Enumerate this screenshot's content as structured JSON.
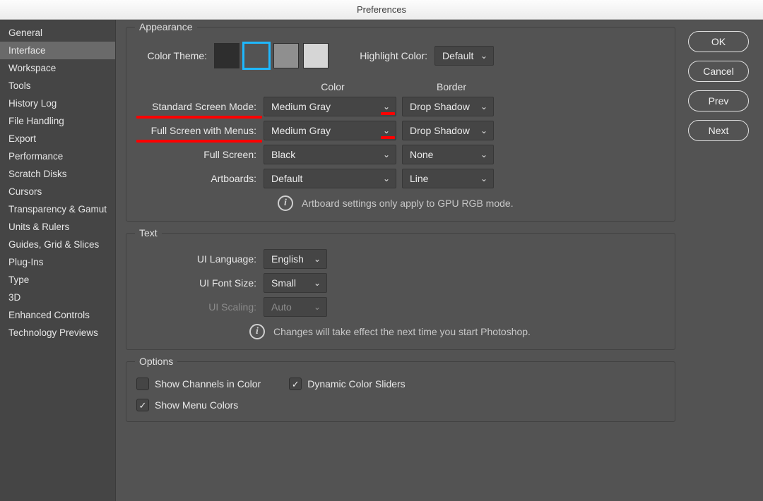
{
  "window": {
    "title": "Preferences"
  },
  "sidebar": {
    "items": [
      {
        "label": "General"
      },
      {
        "label": "Interface",
        "selected": true
      },
      {
        "label": "Workspace"
      },
      {
        "label": "Tools"
      },
      {
        "label": "History Log"
      },
      {
        "label": "File Handling"
      },
      {
        "label": "Export"
      },
      {
        "label": "Performance"
      },
      {
        "label": "Scratch Disks"
      },
      {
        "label": "Cursors"
      },
      {
        "label": "Transparency & Gamut"
      },
      {
        "label": "Units & Rulers"
      },
      {
        "label": "Guides, Grid & Slices"
      },
      {
        "label": "Plug-Ins"
      },
      {
        "label": "Type"
      },
      {
        "label": "3D"
      },
      {
        "label": "Enhanced Controls"
      },
      {
        "label": "Technology Previews"
      }
    ]
  },
  "buttons": {
    "ok": "OK",
    "cancel": "Cancel",
    "prev": "Prev",
    "next": "Next"
  },
  "appearance": {
    "legend": "Appearance",
    "color_theme_label": "Color Theme:",
    "swatches": [
      "#2e2e2e",
      "#535353",
      "#8f8f8f",
      "#d6d6d6"
    ],
    "selected_swatch_index": 1,
    "highlight_color_label": "Highlight Color:",
    "highlight_color_value": "Default",
    "col_color": "Color",
    "col_border": "Border",
    "rows": [
      {
        "label": "Standard Screen Mode:",
        "color": "Medium Gray",
        "border": "Drop Shadow",
        "annot": true
      },
      {
        "label": "Full Screen with Menus:",
        "color": "Medium Gray",
        "border": "Drop Shadow",
        "annot": true
      },
      {
        "label": "Full Screen:",
        "color": "Black",
        "border": "None"
      },
      {
        "label": "Artboards:",
        "color": "Default",
        "border": "Line"
      }
    ],
    "info": "Artboard settings only apply to GPU RGB mode."
  },
  "text": {
    "legend": "Text",
    "ui_language_label": "UI Language:",
    "ui_language_value": "English",
    "ui_font_size_label": "UI Font Size:",
    "ui_font_size_value": "Small",
    "ui_scaling_label": "UI Scaling:",
    "ui_scaling_value": "Auto",
    "ui_scaling_disabled": true,
    "info": "Changes will take effect the next time you start Photoshop."
  },
  "options": {
    "legend": "Options",
    "show_channels_label": "Show Channels in Color",
    "show_channels_checked": false,
    "dynamic_sliders_label": "Dynamic Color Sliders",
    "dynamic_sliders_checked": true,
    "show_menu_colors_label": "Show Menu Colors",
    "show_menu_colors_checked": true
  }
}
